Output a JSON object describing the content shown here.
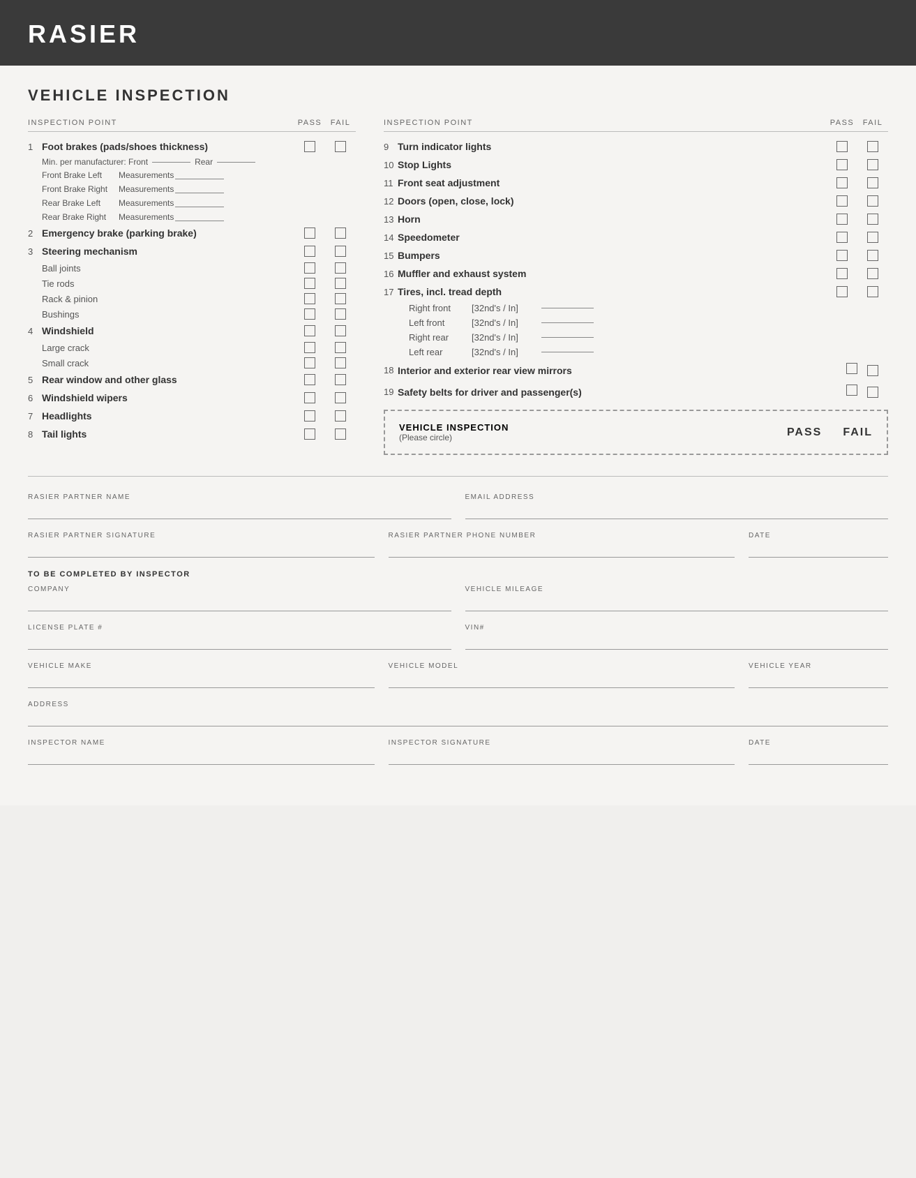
{
  "header": {
    "title": "RASIER"
  },
  "page": {
    "section_title": "VEHICLE INSPECTION"
  },
  "left_col": {
    "header": {
      "inspection_point": "INSPECTION POINT",
      "pass": "PASS",
      "fail": "FAIL"
    },
    "items": [
      {
        "number": "1",
        "label": "Foot brakes (pads/shoes thickness)",
        "bold": true,
        "has_checkbox": true,
        "sub_items": [
          {
            "type": "minline",
            "text": "Min. per manufacturer:  Front",
            "rear": "Rear"
          },
          {
            "type": "meas",
            "label": "Front Brake Left",
            "value": "Measurements"
          },
          {
            "type": "meas",
            "label": "Front Brake Right",
            "value": "Measurements"
          },
          {
            "type": "meas",
            "label": "Rear Brake Left",
            "value": "Measurements"
          },
          {
            "type": "meas",
            "label": "Rear Brake Right",
            "value": "Measurements"
          }
        ]
      },
      {
        "number": "2",
        "label": "Emergency brake (parking brake)",
        "bold": true,
        "has_checkbox": true
      },
      {
        "number": "3",
        "label": "Steering mechanism",
        "bold": true,
        "has_checkbox": true,
        "sub_items": [
          {
            "type": "checkbox_item",
            "label": "Ball joints"
          },
          {
            "type": "checkbox_item",
            "label": "Tie rods"
          },
          {
            "type": "checkbox_item",
            "label": "Rack & pinion"
          },
          {
            "type": "checkbox_item",
            "label": "Bushings"
          }
        ]
      },
      {
        "number": "4",
        "label": "Windshield",
        "bold": true,
        "has_checkbox": true,
        "sub_items": [
          {
            "type": "checkbox_item",
            "label": "Large crack"
          },
          {
            "type": "checkbox_item",
            "label": "Small crack"
          }
        ]
      },
      {
        "number": "5",
        "label": "Rear window and other glass",
        "bold": true,
        "has_checkbox": true
      },
      {
        "number": "6",
        "label": "Windshield wipers",
        "bold": true,
        "has_checkbox": true
      },
      {
        "number": "7",
        "label": "Headlights",
        "bold": true,
        "has_checkbox": true
      },
      {
        "number": "8",
        "label": "Tail lights",
        "bold": true,
        "has_checkbox": true
      }
    ]
  },
  "right_col": {
    "header": {
      "inspection_point": "INSPECTION POINT",
      "pass": "PASS",
      "fail": "FAIL"
    },
    "items": [
      {
        "number": "9",
        "label": "Turn indicator lights",
        "bold": true,
        "has_checkbox": true
      },
      {
        "number": "10",
        "label": "Stop Lights",
        "bold": true,
        "has_checkbox": true
      },
      {
        "number": "11",
        "label": "Front seat adjustment",
        "bold": true,
        "has_checkbox": true
      },
      {
        "number": "12",
        "label": "Doors (open, close, lock)",
        "bold": true,
        "has_checkbox": true
      },
      {
        "number": "13",
        "label": "Horn",
        "bold": true,
        "has_checkbox": true
      },
      {
        "number": "14",
        "label": "Speedometer",
        "bold": true,
        "has_checkbox": true
      },
      {
        "number": "15",
        "label": "Bumpers",
        "bold": true,
        "has_checkbox": true
      },
      {
        "number": "16",
        "label": "Muffler and exhaust system",
        "bold": true,
        "has_checkbox": true
      },
      {
        "number": "17",
        "label": "Tires, incl. tread depth",
        "bold": true,
        "has_checkbox": true,
        "tire_items": [
          {
            "label": "Right front",
            "unit": "[32nd's / In]"
          },
          {
            "label": "Left front",
            "unit": "[32nd's / In]"
          },
          {
            "label": "Right rear",
            "unit": "[32nd's / In]"
          },
          {
            "label": "Left rear",
            "unit": "[32nd's / In]"
          }
        ]
      },
      {
        "number": "18",
        "label": "Interior and exterior rear view mirrors",
        "bold": true,
        "has_checkbox": true
      },
      {
        "number": "19",
        "label": "Safety belts for driver and passenger(s)",
        "bold": true,
        "has_checkbox": true
      }
    ],
    "final_box": {
      "title": "VEHICLE INSPECTION",
      "subtitle": "(Please circle)",
      "pass": "PASS",
      "fail": "FAIL"
    }
  },
  "form": {
    "to_be_completed": "TO BE COMPLETED BY INSPECTOR",
    "fields": {
      "partner_name": "RASIER PARTNER NAME",
      "email": "EMAIL ADDRESS",
      "signature": "RASIER PARTNER SIGNATURE",
      "phone": "RASIER PARTNER PHONE NUMBER",
      "date1": "DATE",
      "company": "COMPANY",
      "mileage": "VEHICLE MILEAGE",
      "license": "LICENSE PLATE #",
      "vin": "VIN#",
      "make": "VEHICLE MAKE",
      "model": "VEHICLE MODEL",
      "year": "VEHICLE YEAR",
      "address": "ADDRESS",
      "inspector_name": "INSPECTOR NAME",
      "inspector_sig": "INSPECTOR SIGNATURE",
      "date2": "DATE"
    }
  }
}
